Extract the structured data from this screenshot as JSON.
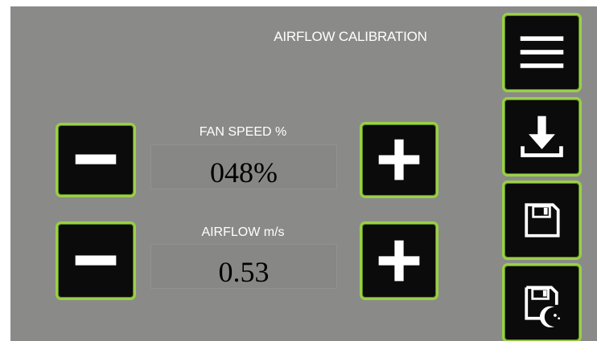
{
  "screen": {
    "title": "AIRFLOW CALIBRATION"
  },
  "fan_speed": {
    "label": "FAN SPEED %",
    "value": "048%"
  },
  "airflow": {
    "label": "AIRFLOW m/s",
    "value": "0.53"
  },
  "side_menu": {
    "items": [
      {
        "name": "menu",
        "icon": "hamburger-menu-icon"
      },
      {
        "name": "download",
        "icon": "download-icon"
      },
      {
        "name": "save",
        "icon": "floppy-disk-icon"
      },
      {
        "name": "save-night",
        "icon": "floppy-disk-moon-icon"
      }
    ]
  },
  "colors": {
    "background": "#8a8b89",
    "button": "#0b0b0b",
    "button_border": "#9ad045",
    "text": "#ffffff"
  }
}
